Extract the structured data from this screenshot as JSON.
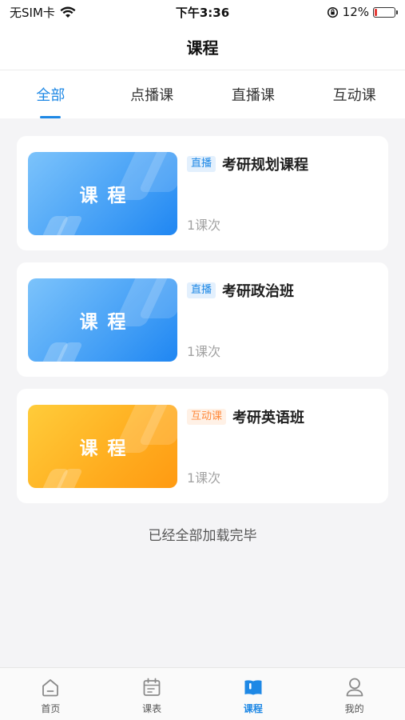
{
  "status_bar": {
    "carrier": "无SIM卡",
    "time": "下午3:36",
    "battery_percent": "12%",
    "battery_level": 0.12,
    "battery_color": "#e53935"
  },
  "nav": {
    "title": "课程"
  },
  "tabs": [
    {
      "label": "全部",
      "active": true
    },
    {
      "label": "点播课",
      "active": false
    },
    {
      "label": "直播课",
      "active": false
    },
    {
      "label": "互动课",
      "active": false
    }
  ],
  "courses": [
    {
      "thumb_text": "课程",
      "thumb_color": "blue",
      "badge": "直播",
      "badge_type": "live",
      "title": "考研规划课程",
      "lessons": "1课次"
    },
    {
      "thumb_text": "课程",
      "thumb_color": "blue",
      "badge": "直播",
      "badge_type": "live",
      "title": "考研政治班",
      "lessons": "1课次"
    },
    {
      "thumb_text": "课程",
      "thumb_color": "orange",
      "badge": "互动课",
      "badge_type": "interactive",
      "title": "考研英语班",
      "lessons": "1课次"
    }
  ],
  "end_text": "已经全部加载完毕",
  "tabbar": [
    {
      "label": "首页",
      "icon": "home-icon",
      "active": false
    },
    {
      "label": "课表",
      "icon": "calendar-icon",
      "active": false
    },
    {
      "label": "课程",
      "icon": "book-icon",
      "active": true
    },
    {
      "label": "我的",
      "icon": "user-icon",
      "active": false
    }
  ],
  "colors": {
    "accent": "#1e88e5",
    "live_badge_bg": "#e3f0fd",
    "interactive_badge_text": "#ff8a3d"
  }
}
